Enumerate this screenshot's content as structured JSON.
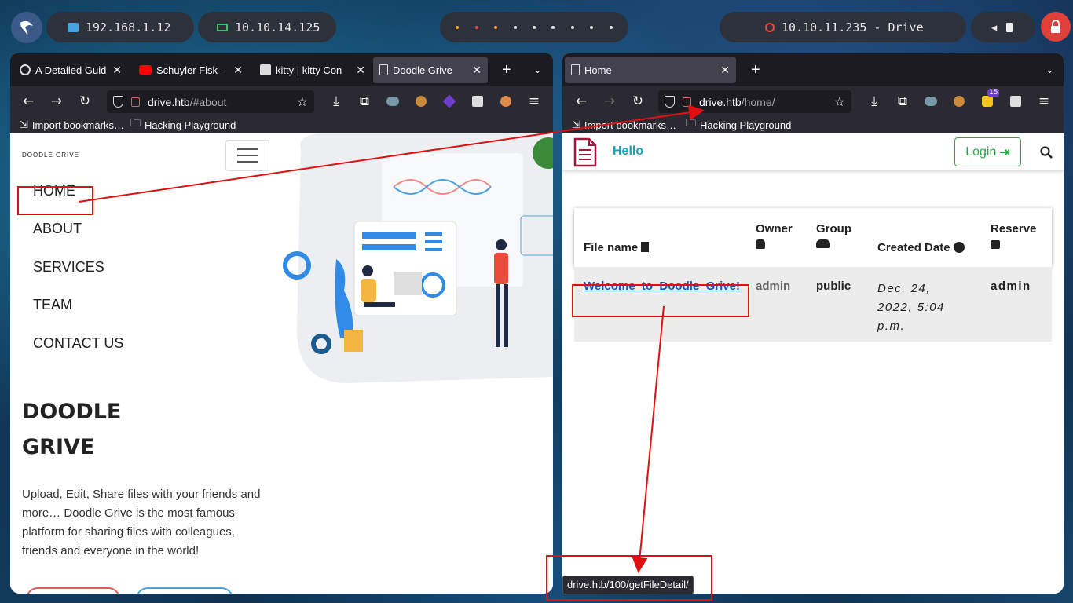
{
  "topbar": {
    "ip_local": "192.168.1.12",
    "ip_vpn": "10.10.14.125",
    "target": "10.10.11.235 - Drive",
    "dot_colors": [
      "#f5a623",
      "#e94b3c",
      "#f5a623",
      "#dddddd",
      "#dddddd",
      "#dddddd",
      "#dddddd",
      "#dddddd",
      "#dddddd"
    ]
  },
  "left_browser": {
    "tabs": [
      {
        "title": "A Detailed Guid",
        "icon": "wordpress-icon"
      },
      {
        "title": "Schuyler Fisk - ",
        "icon": "youtube-icon"
      },
      {
        "title": "kitty | kitty Con",
        "icon": "kitty-icon"
      },
      {
        "title": "Doodle Grive",
        "icon": "page-icon"
      }
    ],
    "url_host": "drive.htb",
    "url_path": "/#about",
    "bookmarks": [
      "Import bookmarks…",
      "Hacking Playground"
    ],
    "page": {
      "brand": "DOODLE GRIVE",
      "menu": [
        "HOME",
        "ABOUT",
        "SERVICES",
        "TEAM",
        "CONTACT US"
      ],
      "title_line1": "DOODLE",
      "title_line2": "GRIVE",
      "description": "Upload, Edit, Share files with your friends and more… Doodle Grive is the most famous platform for sharing files with colleagues, friends and everyone in the world!"
    }
  },
  "right_browser": {
    "tabs": [
      {
        "title": "Home",
        "icon": "page-icon"
      }
    ],
    "url_host": "drive.htb",
    "url_path": "/home/",
    "extension_badge": "15",
    "bookmarks": [
      "Import bookmarks…",
      "Hacking Playground"
    ],
    "page": {
      "hello": "Hello",
      "login": "Login",
      "columns": {
        "file_name": "File name",
        "owner": "Owner",
        "group": "Group",
        "created": "Created Date",
        "reserve": "Reserve"
      },
      "rows": [
        {
          "file": "Welcome_to_Doodle_Grive!",
          "owner": "admin",
          "group": "public",
          "created_l1": "Dec. 24,",
          "created_l2": "2022, 5:04",
          "created_l3": "p.m.",
          "reserve": "admin"
        }
      ]
    },
    "status_url": "drive.htb/100/getFileDetail/"
  },
  "colors": {
    "accent_teal": "#17a2b8",
    "login_green": "#28a745",
    "annotation_red": "#e01010",
    "doc_icon": "#a0183c"
  }
}
